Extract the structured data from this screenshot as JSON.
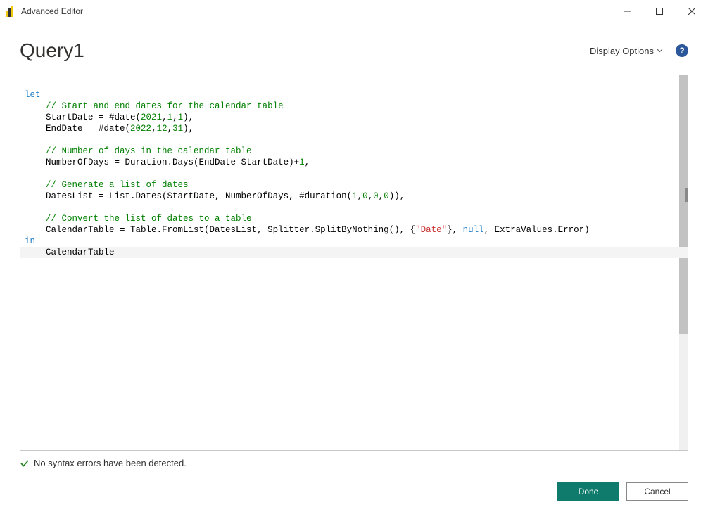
{
  "window": {
    "title": "Advanced Editor"
  },
  "header": {
    "query_name": "Query1",
    "display_options_label": "Display Options",
    "help_glyph": "?"
  },
  "code": {
    "let_kw": "let",
    "in_kw": "in",
    "null_kw": "null",
    "cmt1": "// Start and end dates for the calendar table",
    "l1a": "StartDate = #date(",
    "l1n1": "2021",
    "l1c": ",",
    "l1n2": "1",
    "l1n3": "1",
    "l1end": "),",
    "l2a": "EndDate = #date(",
    "l2n1": "2022",
    "l2n2": "12",
    "l2n3": "31",
    "l2end": "),",
    "cmt2": "// Number of days in the calendar table",
    "l3a": "NumberOfDays = Duration.Days(EndDate-StartDate)+",
    "l3n": "1",
    "l3end": ",",
    "cmt3": "// Generate a list of dates",
    "l4a": "DatesList = List.Dates(StartDate, NumberOfDays, #duration(",
    "l4n1": "1",
    "l4n2": "0",
    "l4n3": "0",
    "l4n4": "0",
    "l4end": ")),",
    "cmt4": "// Convert the list of dates to a table",
    "l5a": "CalendarTable = Table.FromList(DatesList, Splitter.SplitByNothing(), {",
    "l5s": "\"Date\"",
    "l5b": "}, ",
    "l5c": ", ExtraValues.Error)",
    "l6": "CalendarTable"
  },
  "status": {
    "message": "No syntax errors have been detected."
  },
  "footer": {
    "done": "Done",
    "cancel": "Cancel"
  }
}
